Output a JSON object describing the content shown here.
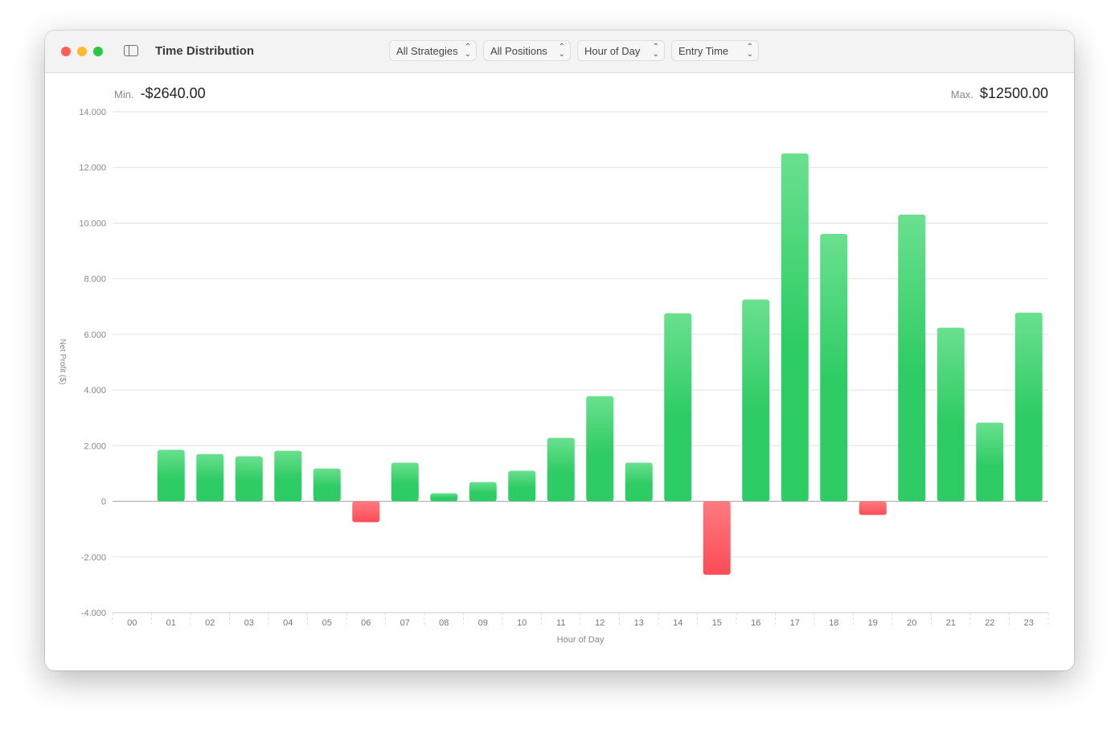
{
  "window": {
    "title": "Time Distribution"
  },
  "toolbar": {
    "filters": [
      {
        "value": "All Strategies"
      },
      {
        "value": "All Positions"
      },
      {
        "value": "Hour of Day"
      },
      {
        "value": "Entry Time"
      }
    ]
  },
  "summary": {
    "min_label": "Min.",
    "min_value": "-$2640.00",
    "max_label": "Max.",
    "max_value": "$12500.00"
  },
  "colors": {
    "positive": "#2ecc64",
    "negative": "#fc4c57",
    "close": "#fe5f57",
    "minimize": "#febc2e",
    "zoom": "#28c840"
  },
  "chart_data": {
    "type": "bar",
    "xlabel": "Hour of Day",
    "ylabel": "Net Profit ($)",
    "ylim": [
      -4000,
      14000
    ],
    "yticks": [
      14000,
      12000,
      10000,
      8000,
      6000,
      4000,
      2000,
      0,
      -2000,
      -4000
    ],
    "ytick_labels": [
      "14.000",
      "12.000",
      "10.000",
      "8.000",
      "6.000",
      "4.000",
      "2.000",
      "0",
      "-2.000",
      "-4.000"
    ],
    "grid": true,
    "categories": [
      "00",
      "01",
      "02",
      "03",
      "04",
      "05",
      "06",
      "07",
      "08",
      "09",
      "10",
      "11",
      "12",
      "13",
      "14",
      "15",
      "16",
      "17",
      "18",
      "19",
      "20",
      "21",
      "22",
      "23"
    ],
    "values": [
      0,
      1850,
      1700,
      1620,
      1820,
      1180,
      -750,
      1390,
      290,
      690,
      1100,
      2280,
      3780,
      1390,
      6760,
      -2640,
      7250,
      12500,
      9610,
      -490,
      10300,
      6240,
      2830,
      6780
    ]
  }
}
